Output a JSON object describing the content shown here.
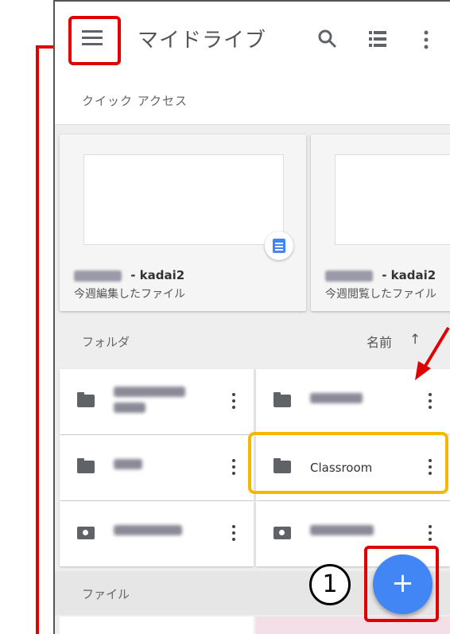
{
  "appbar": {
    "title": "マイドライブ"
  },
  "quick_access": {
    "label": "クイック アクセス",
    "cards": [
      {
        "name_suffix": " - kadai2",
        "subtitle": "今週編集したファイル"
      },
      {
        "name_suffix": " - kadai2",
        "subtitle": "今週閲覧したファイル"
      }
    ]
  },
  "folders": {
    "label": "フォルダ",
    "sort_label": "名前",
    "sort_icon": "↑",
    "items": [
      {
        "name": ""
      },
      {
        "name": ""
      },
      {
        "name": ""
      },
      {
        "name": "Classroom"
      },
      {
        "name": ""
      },
      {
        "name": ""
      }
    ]
  },
  "files": {
    "label": "ファイル"
  },
  "fab": {
    "label": "+"
  },
  "annotation": {
    "step": "1"
  },
  "colors": {
    "accent": "#4285f4",
    "annotation_red": "#e00000",
    "annotation_yellow": "#f5b800"
  }
}
